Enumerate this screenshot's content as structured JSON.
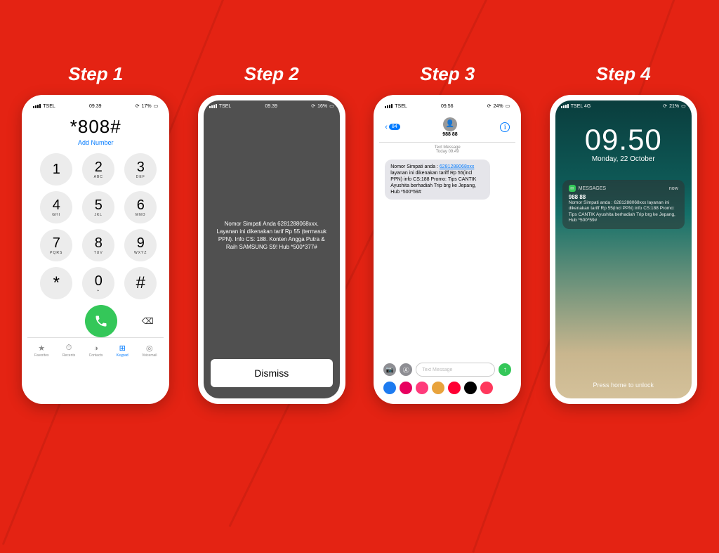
{
  "labels": {
    "step1": "Step 1",
    "step2": "Step 2",
    "step3": "Step 3",
    "step4": "Step 4"
  },
  "step1": {
    "carrier": "TSEL",
    "time": "09.39",
    "battery": "17%",
    "number": "*808#",
    "add_number": "Add Number",
    "keys": [
      {
        "d": "1",
        "l": ""
      },
      {
        "d": "2",
        "l": "ABC"
      },
      {
        "d": "3",
        "l": "DEF"
      },
      {
        "d": "4",
        "l": "GHI"
      },
      {
        "d": "5",
        "l": "JKL"
      },
      {
        "d": "6",
        "l": "MNO"
      },
      {
        "d": "7",
        "l": "PQRS"
      },
      {
        "d": "8",
        "l": "TUV"
      },
      {
        "d": "9",
        "l": "WXYZ"
      },
      {
        "d": "*",
        "l": ""
      },
      {
        "d": "0",
        "l": "+"
      },
      {
        "d": "#",
        "l": ""
      }
    ],
    "tabs": [
      {
        "ico": "★",
        "label": "Favorites"
      },
      {
        "ico": "⏱",
        "label": "Recents"
      },
      {
        "ico": "◑",
        "label": "Contacts"
      },
      {
        "ico": "⊞",
        "label": "Keypad"
      },
      {
        "ico": "◎",
        "label": "Voicemail"
      }
    ]
  },
  "step2": {
    "carrier": "TSEL",
    "time": "09.39",
    "battery": "16%",
    "message": "Nomor Simpati Anda 6281288068xxx. Layanan ini dikenakan tarif Rp 55 (termasuk PPN). Info CS: 188. Konten Angga Putra & Raih SAMSUNG S9! Hub *500*377#",
    "dismiss": "Dismiss"
  },
  "step3": {
    "carrier": "TSEL",
    "time": "09.56",
    "battery": "24%",
    "back_badge": "84",
    "sender": "988 88",
    "meta_label": "Text Message",
    "meta_time": "Today 09.49",
    "bubble_pre": "Nomor Simpati anda : ",
    "bubble_link": "6281288068xxx",
    "bubble_post": " layanan ini dikenakan tariff Rp 55(incl PPN) info CS:188 Promo: Tips CANTIK Ayushita berhadiah Trip brg ke Jepang, Hub *500*59#",
    "placeholder": "Text Message",
    "apps": [
      "#1d7bf0",
      "#e8005f",
      "#ff3b7b",
      "#e8a33c",
      "#ff0033",
      "#000000",
      "#ff385c"
    ]
  },
  "step4": {
    "carrier": "TSEL  4G",
    "battery": "21%",
    "time": "09.50",
    "date": "Monday, 22 October",
    "notif_app": "MESSAGES",
    "notif_when": "now",
    "notif_sender": "988 88",
    "notif_body": "Nomor Simpati anda : 6281288068xxx layanan ini dikenakan tariff Rp 55(incl PPN) info CS:188 Promo: Tips CANTIK Ayushita berhadiah Trip brg ke Jepang, Hub *500*59#",
    "unlock": "Press home to unlock"
  }
}
